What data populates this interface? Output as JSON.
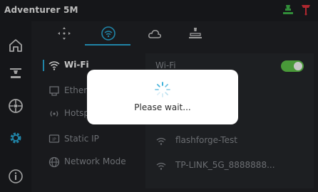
{
  "app": {
    "title": "Adventurer 5M"
  },
  "status_icons": [
    "printer-status-icon",
    "filament-status-icon"
  ],
  "sidebar": {
    "items": [
      "home-icon",
      "print-icon",
      "filament-icon",
      "settings-icon",
      "info-icon"
    ],
    "active": "settings-icon"
  },
  "tabs": {
    "items": [
      "move-axes-icon",
      "network-icon",
      "cloud-icon",
      "print-bed-icon"
    ],
    "active": "network-icon"
  },
  "subnav": [
    {
      "label": "Wi-Fi",
      "icon": "wifi-icon",
      "active": true
    },
    {
      "label": "Ethernet",
      "icon": "ethernet-icon",
      "active": false
    },
    {
      "label": "Hotspot",
      "icon": "hotspot-icon",
      "active": false
    },
    {
      "label": "Static IP",
      "icon": "ip-icon",
      "active": false
    },
    {
      "label": "Network Mode",
      "icon": "globe-icon",
      "active": false
    }
  ],
  "wifi": {
    "label": "Wi-Fi",
    "enabled": true,
    "networks": [
      {
        "name": "flashforge-Test"
      },
      {
        "name": "TP-LINK_5G_8888888..."
      }
    ]
  },
  "dialog": {
    "message": "Please wait..."
  },
  "colors": {
    "accent": "#2aa9d6",
    "toggle_on": "#5ec54a",
    "status_green": "#3fb54a",
    "status_red": "#e0343d"
  }
}
